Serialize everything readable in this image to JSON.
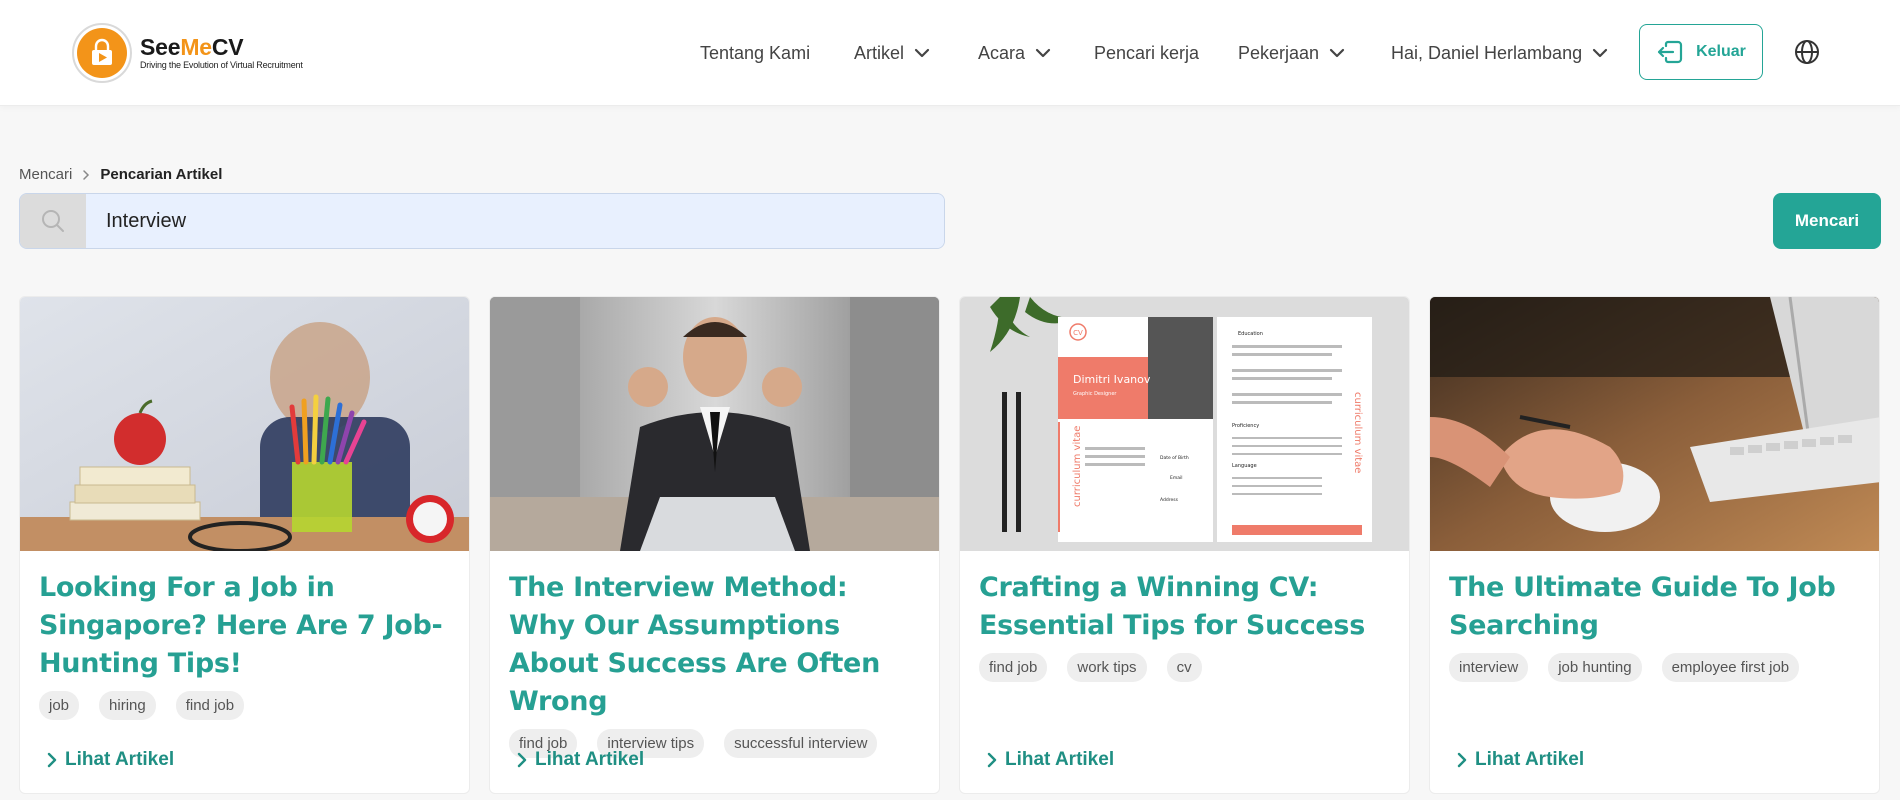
{
  "brand": {
    "name_prefix": "See",
    "name_highlight": "Me",
    "name_suffix": "CV",
    "tagline": "Driving the Evolution of Virtual Recruitment"
  },
  "nav": {
    "items": [
      {
        "label": "Tentang Kami",
        "dropdown": false
      },
      {
        "label": "Artikel",
        "dropdown": true
      },
      {
        "label": "Acara",
        "dropdown": true
      },
      {
        "label": "Pencari kerja",
        "dropdown": false
      },
      {
        "label": "Pekerjaan",
        "dropdown": true
      },
      {
        "label": "Hai, Daniel Herlambang",
        "dropdown": true
      }
    ],
    "logout_label": "Keluar"
  },
  "breadcrumb": {
    "parent": "Mencari",
    "current": "Pencarian Artikel"
  },
  "search": {
    "value": "Interview",
    "placeholder": "",
    "button_label": "Mencari"
  },
  "articles": [
    {
      "title": "Looking For a Job in Singapore? Here Are 7 Job-Hunting Tips!",
      "tags": [
        "job",
        "hiring",
        "find job"
      ],
      "link_label": "Lihat Artikel"
    },
    {
      "title": "The Interview Method: Why Our Assumptions About Success Are Often Wrong",
      "tags": [
        "find job",
        "interview tips",
        "successful interview"
      ],
      "link_label": "Lihat Artikel"
    },
    {
      "title": "Crafting a Winning CV: Essential Tips for Success",
      "tags": [
        "find job",
        "work tips",
        "cv"
      ],
      "link_label": "Lihat Artikel"
    },
    {
      "title": "The Ultimate Guide To Job Searching",
      "tags": [
        "interview",
        "job hunting",
        "employee first job"
      ],
      "link_label": "Lihat Artikel"
    }
  ],
  "cv_image": {
    "badge": "CV",
    "name": "Dimitri Ivanov",
    "role": "Graphic Designer",
    "side_text": "curriculum vitae",
    "headings": [
      "Education",
      "Proficiency",
      "Language"
    ],
    "contact_labels": [
      "Date of Birth",
      "Email",
      "Address"
    ]
  },
  "colors": {
    "accent": "#24a596",
    "title": "#26a093",
    "brand_orange": "#f39419"
  }
}
